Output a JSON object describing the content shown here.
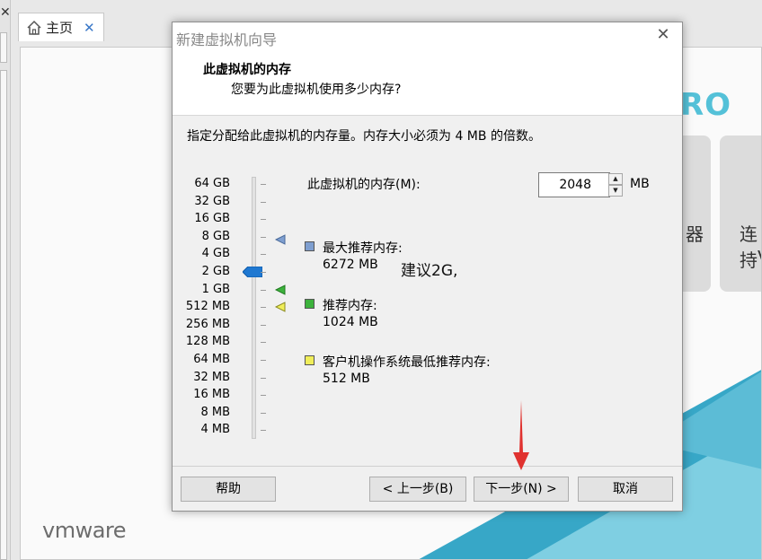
{
  "window": {
    "home_tab_label": "主页",
    "home_tab_close": "✕",
    "side_close": "✕",
    "pro_text": "RO",
    "card1_text": "器",
    "card2_text": "连持",
    "card2_text2": "V",
    "brand_logo": "vmware"
  },
  "dialog": {
    "title": "新建虚拟机向导",
    "close_symbol": "✕",
    "header_title": "此虚拟机的内存",
    "header_subtitle": "您要为此虚拟机使用多少内存?",
    "instruction": "指定分配给此虚拟机的内存量。内存大小必须为 4 MB 的倍数。",
    "memory_label": "此虚拟机的内存(M):",
    "memory_value": "2048",
    "memory_unit": "MB",
    "scale_ticks": [
      "64 GB",
      "32 GB",
      "16 GB",
      "8 GB",
      "4 GB",
      "2 GB",
      "1 GB",
      "512 MB",
      "256 MB",
      "128 MB",
      "64 MB",
      "32 MB",
      "16 MB",
      "8 MB",
      "4 MB"
    ],
    "slider_selected": "2 GB",
    "legend": [
      {
        "title": "最大推荐内存:",
        "value": "6272 MB",
        "color": "#7f9fd0"
      },
      {
        "title": "推荐内存:",
        "value": "1024 MB",
        "color": "#3cb23c"
      },
      {
        "title": "客户机操作系统最低推荐内存:",
        "value": "512 MB",
        "color": "#f0ee5a"
      }
    ],
    "note": "建议2G,",
    "buttons": {
      "help": "帮助",
      "back": "< 上一步(B)",
      "next": "下一步(N) >",
      "cancel": "取消"
    }
  },
  "colors": {
    "slider_thumb": "#1f78d1",
    "annotation_arrow": "#e0322f",
    "pro_accent": "#54c1d8"
  }
}
